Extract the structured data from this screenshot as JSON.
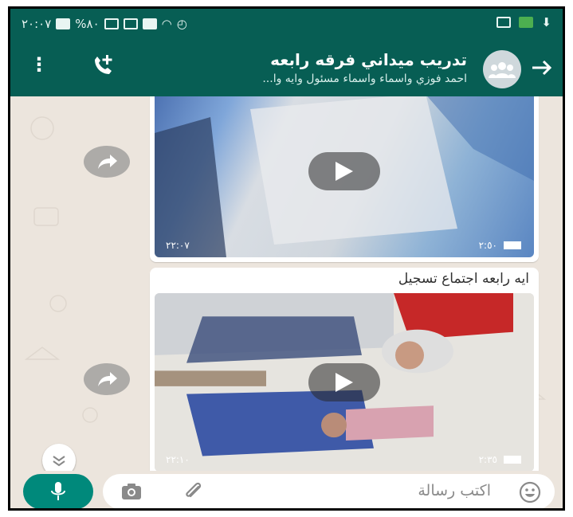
{
  "status_bar": {
    "time": "٢٠:٠٧",
    "battery": "%٨٠"
  },
  "header": {
    "title": "تدريب ميداني فرقه رابعه",
    "subtitle": "احمد فوزي واسماء واسماء مسئول وايه وا..."
  },
  "messages": [
    {
      "duration": "٢:٥٠",
      "time": "٢٢:٠٧",
      "caption": ""
    },
    {
      "duration": "٢:٣٥",
      "time": "٢٢:١٠",
      "caption": "ايه رابعه اجتماع تسجيل"
    }
  ],
  "input": {
    "placeholder": "اكتب رسالة"
  },
  "colors": {
    "header": "#075e54",
    "accent": "#00897b",
    "chat_bg": "#ece5dd"
  },
  "icons": [
    "more-vert-icon",
    "add-call-icon",
    "group-avatar-icon",
    "back-arrow-icon",
    "forward-icon",
    "play-icon",
    "video-camera-icon",
    "scroll-down-icon",
    "mic-icon",
    "camera-icon",
    "attach-icon",
    "emoji-icon"
  ]
}
